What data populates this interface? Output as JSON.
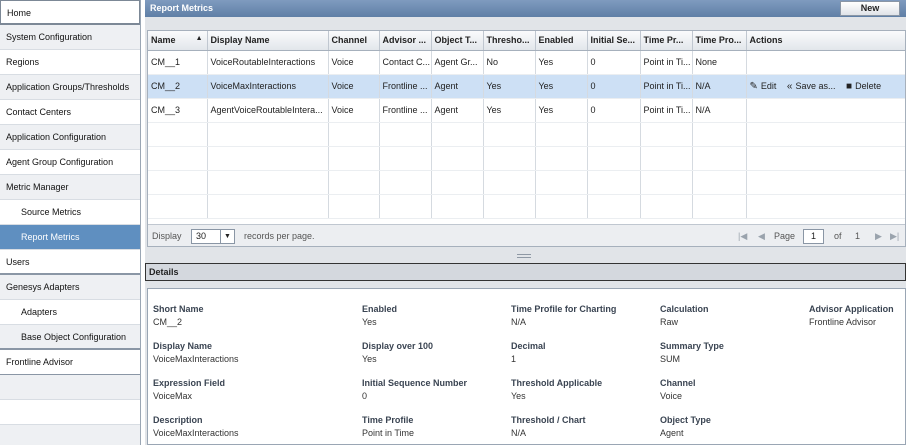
{
  "sidebar": {
    "items": [
      {
        "label": "Home"
      },
      {
        "label": "System Configuration"
      },
      {
        "label": "Regions"
      },
      {
        "label": "Application Groups/Thresholds"
      },
      {
        "label": "Contact Centers"
      },
      {
        "label": "Application Configuration"
      },
      {
        "label": "Agent Group Configuration"
      },
      {
        "label": "Metric Manager"
      },
      {
        "label": "Source Metrics"
      },
      {
        "label": "Report Metrics"
      },
      {
        "label": "Users"
      },
      {
        "label": "Genesys Adapters"
      },
      {
        "label": "Adapters"
      },
      {
        "label": "Base Object Configuration"
      },
      {
        "label": "Frontline Advisor"
      }
    ]
  },
  "panel": {
    "title": "Report Metrics",
    "new_label": "New"
  },
  "grid": {
    "columns": [
      "Name",
      "Display Name",
      "Channel",
      "Advisor ...",
      "Object T...",
      "Thresho...",
      "Enabled",
      "Initial Se...",
      "Time Pr...",
      "Time Pro...",
      "Actions"
    ],
    "sort_indicator": "▲",
    "rows": [
      [
        "CM__1",
        "VoiceRoutableInteractions",
        "Voice",
        "Contact C...",
        "Agent Gr...",
        "No",
        "Yes",
        "0",
        "Point in Ti...",
        "None"
      ],
      [
        "CM__2",
        "VoiceMaxInteractions",
        "Voice",
        "Frontline ...",
        "Agent",
        "Yes",
        "Yes",
        "0",
        "Point in Ti...",
        "N/A"
      ],
      [
        "CM__3",
        "AgentVoiceRoutableIntera...",
        "Voice",
        "Frontline ...",
        "Agent",
        "Yes",
        "Yes",
        "0",
        "Point in Ti...",
        "N/A"
      ]
    ],
    "actions": {
      "edit": "Edit",
      "save_as": "Save as...",
      "delete": "Delete"
    },
    "pager": {
      "display": "Display",
      "page_size": "30",
      "records_per_page": "records per page.",
      "page": "Page",
      "page_value": "1",
      "of": "of",
      "total_pages": "1"
    }
  },
  "details": {
    "title": "Details",
    "fields": {
      "short_name": {
        "label": "Short Name",
        "value": "CM__2"
      },
      "enabled": {
        "label": "Enabled",
        "value": "Yes"
      },
      "time_profile_charting": {
        "label": "Time Profile for Charting",
        "value": "N/A"
      },
      "calculation": {
        "label": "Calculation",
        "value": "Raw"
      },
      "advisor_application": {
        "label": "Advisor Application",
        "value": "Frontline Advisor"
      },
      "display_name": {
        "label": "Display Name",
        "value": "VoiceMaxInteractions"
      },
      "display_over_100": {
        "label": "Display over 100",
        "value": "Yes"
      },
      "decimal": {
        "label": "Decimal",
        "value": "1"
      },
      "summary_type": {
        "label": "Summary Type",
        "value": "SUM"
      },
      "expression_field": {
        "label": "Expression Field",
        "value": "VoiceMax"
      },
      "initial_sequence": {
        "label": "Initial Sequence Number",
        "value": "0"
      },
      "threshold_applicable": {
        "label": "Threshold Applicable",
        "value": "Yes"
      },
      "channel": {
        "label": "Channel",
        "value": "Voice"
      },
      "description": {
        "label": "Description",
        "value": "VoiceMaxInteractions"
      },
      "time_profile": {
        "label": "Time Profile",
        "value": "Point in Time"
      },
      "threshold_chart": {
        "label": "Threshold / Chart",
        "value": "N/A"
      },
      "object_type": {
        "label": "Object Type",
        "value": "Agent"
      }
    }
  },
  "colors": {
    "header": "#6f8db3",
    "selected_nav": "#5f8fc0",
    "selected_row": "#cde0f5"
  }
}
